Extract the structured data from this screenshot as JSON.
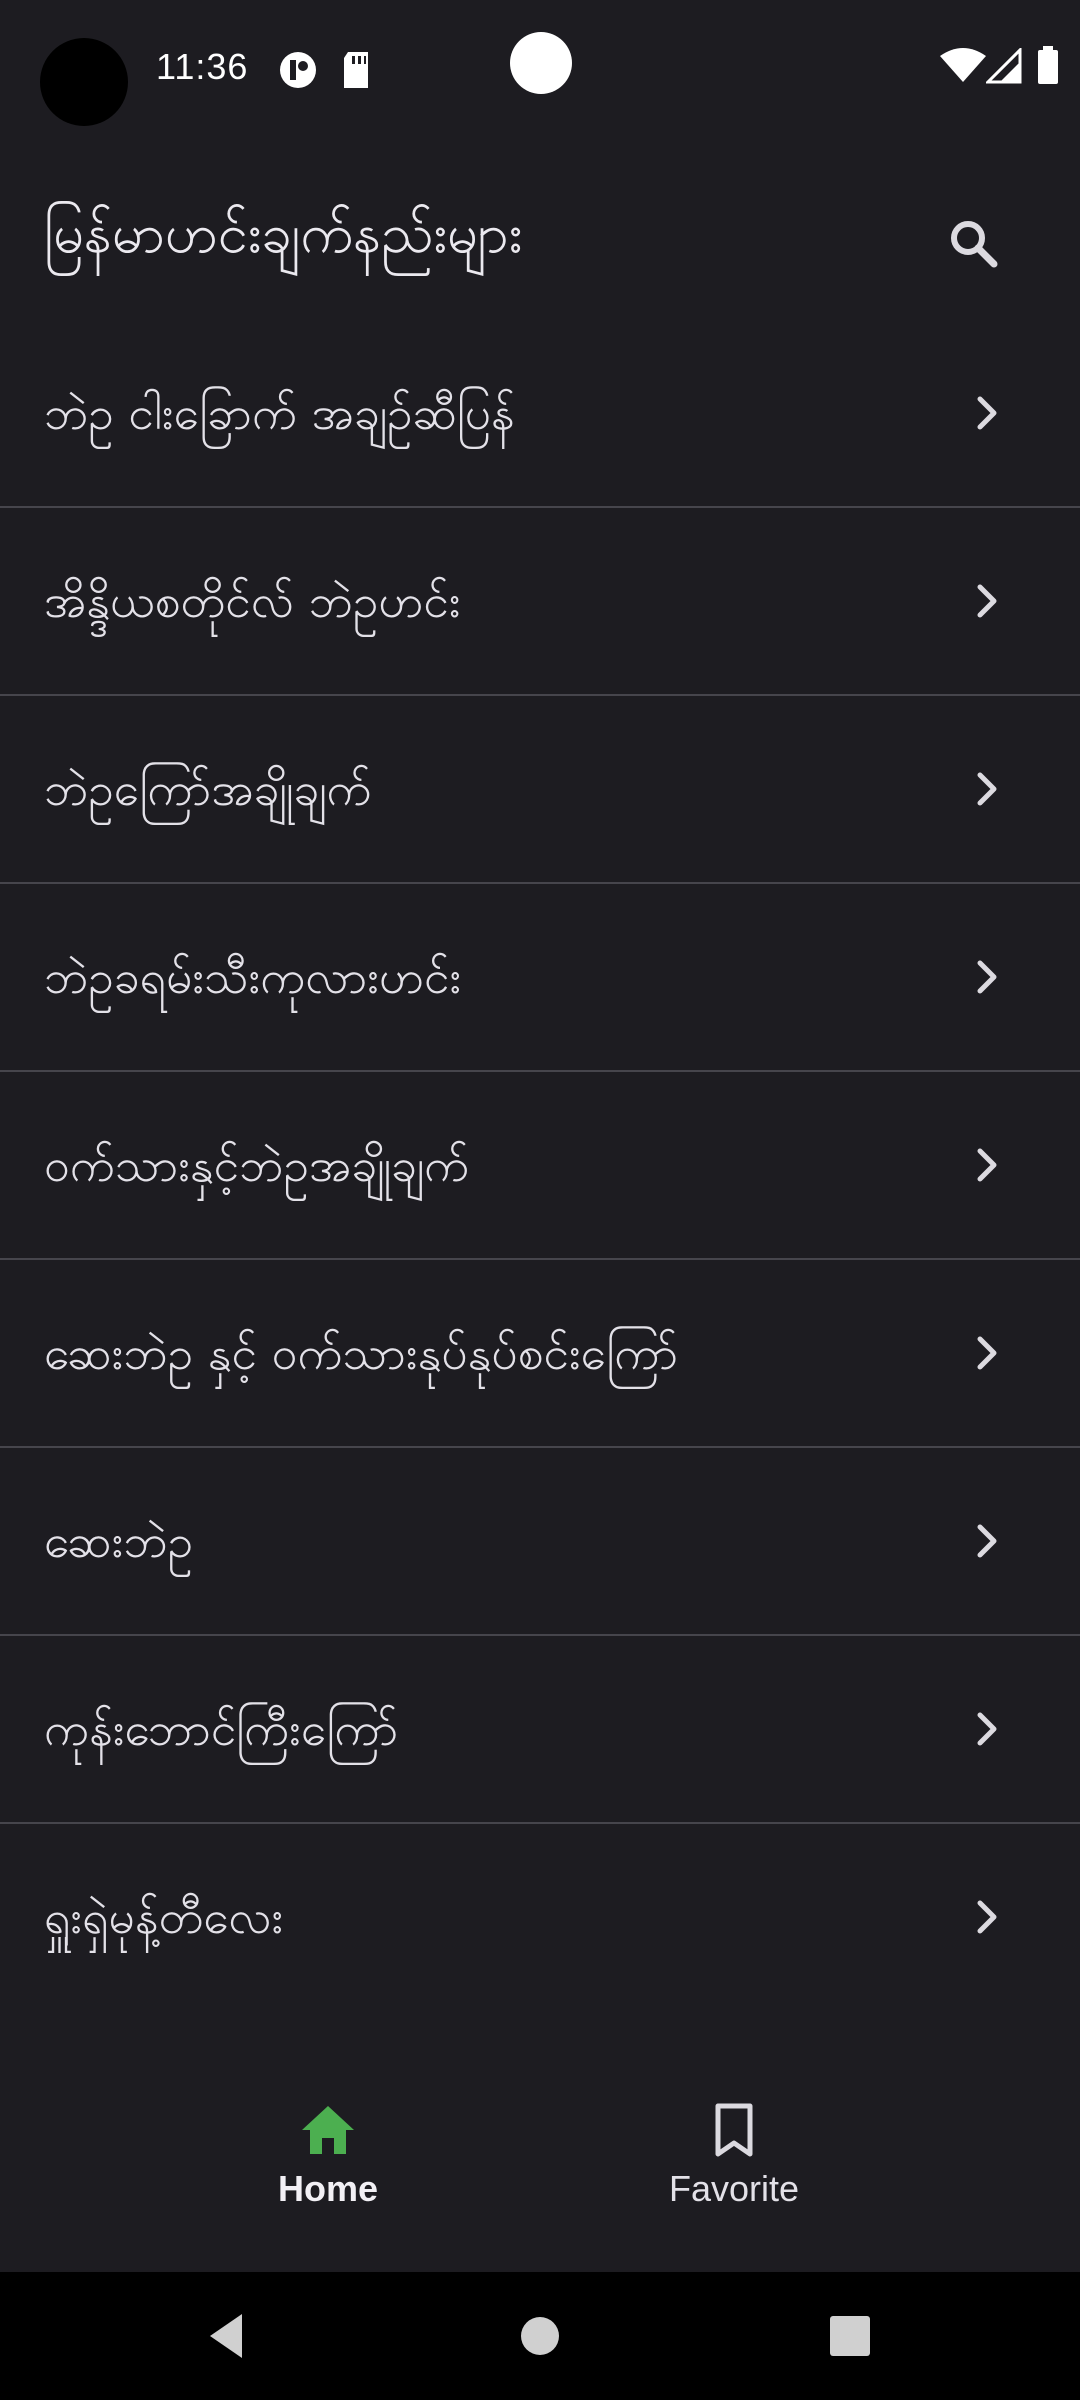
{
  "status_bar": {
    "time": "11:36"
  },
  "app_bar": {
    "title": "မြန်မာဟင်းချက်နည်းများ",
    "search_icon": "search-icon"
  },
  "list": {
    "items": [
      {
        "label": "ဘဲဥ ငါးခြောက် အချဉ်ဆီပြန်"
      },
      {
        "label": "အိန္ဒိယစတိုင်လ် ဘဲဥဟင်း"
      },
      {
        "label": "ဘဲဥကြော်အချိုချက်"
      },
      {
        "label": "ဘဲဥခရမ်းသီးကုလားဟင်း"
      },
      {
        "label": "ဝက်သားနှင့်ဘဲဥအချိုချက်"
      },
      {
        "label": "ဆေးဘဲဥ နှင့် ဝက်သားနုပ်နုပ်စင်းကြော်"
      },
      {
        "label": "ဆေးဘဲဥ"
      },
      {
        "label": "ကုန်းဘောင်ကြီးကြော်"
      },
      {
        "label": "ရှူးရှဲမုန့်တီလေး"
      }
    ]
  },
  "bottom_nav": {
    "home_label": "Home",
    "favorite_label": "Favorite",
    "active": "home"
  },
  "colors": {
    "background": "#1d1c21",
    "divider": "#46454c",
    "home_icon_active": "#4caf50",
    "text": "#e3e1e8"
  }
}
